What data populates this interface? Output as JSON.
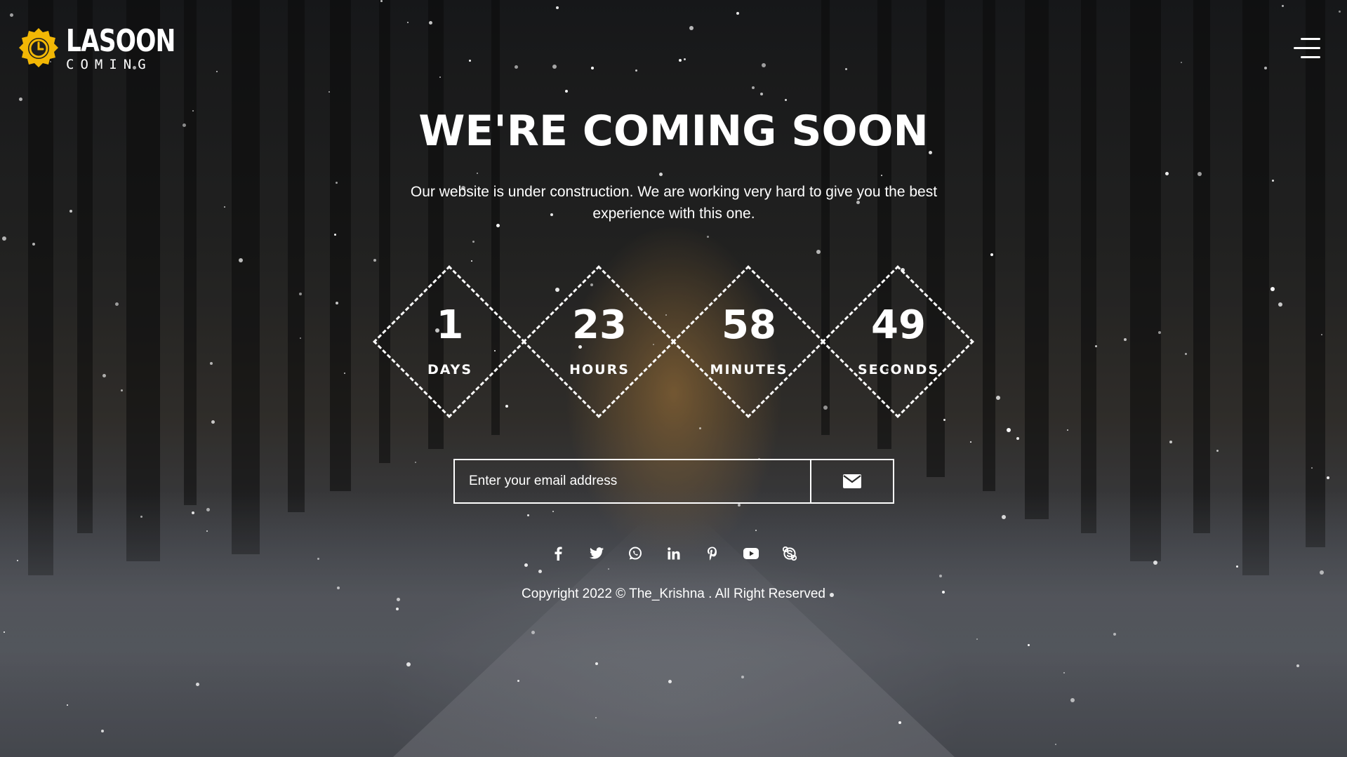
{
  "brand": {
    "name": "LASOON",
    "tagline": "COMING",
    "accent": "#f2b705"
  },
  "header": {
    "menu_icon": "hamburger-menu-icon"
  },
  "hero": {
    "title": "WE'RE COMING SOON",
    "description": "Our website is under construction. We are working very hard to give you the best experience with this one."
  },
  "countdown": [
    {
      "value": "1",
      "label": "DAYS"
    },
    {
      "value": "23",
      "label": "HOURS"
    },
    {
      "value": "58",
      "label": "MINUTES"
    },
    {
      "value": "49",
      "label": "SECONDS"
    }
  ],
  "subscribe": {
    "placeholder": "Enter your email address",
    "button_icon": "envelope-icon"
  },
  "social": [
    {
      "name": "facebook-icon"
    },
    {
      "name": "twitter-icon"
    },
    {
      "name": "whatsapp-icon"
    },
    {
      "name": "linkedin-icon"
    },
    {
      "name": "pinterest-icon"
    },
    {
      "name": "youtube-icon"
    },
    {
      "name": "skype-icon"
    }
  ],
  "footer": {
    "copyright": "Copyright 2022 © The_Krishna . All Right Reserved"
  }
}
